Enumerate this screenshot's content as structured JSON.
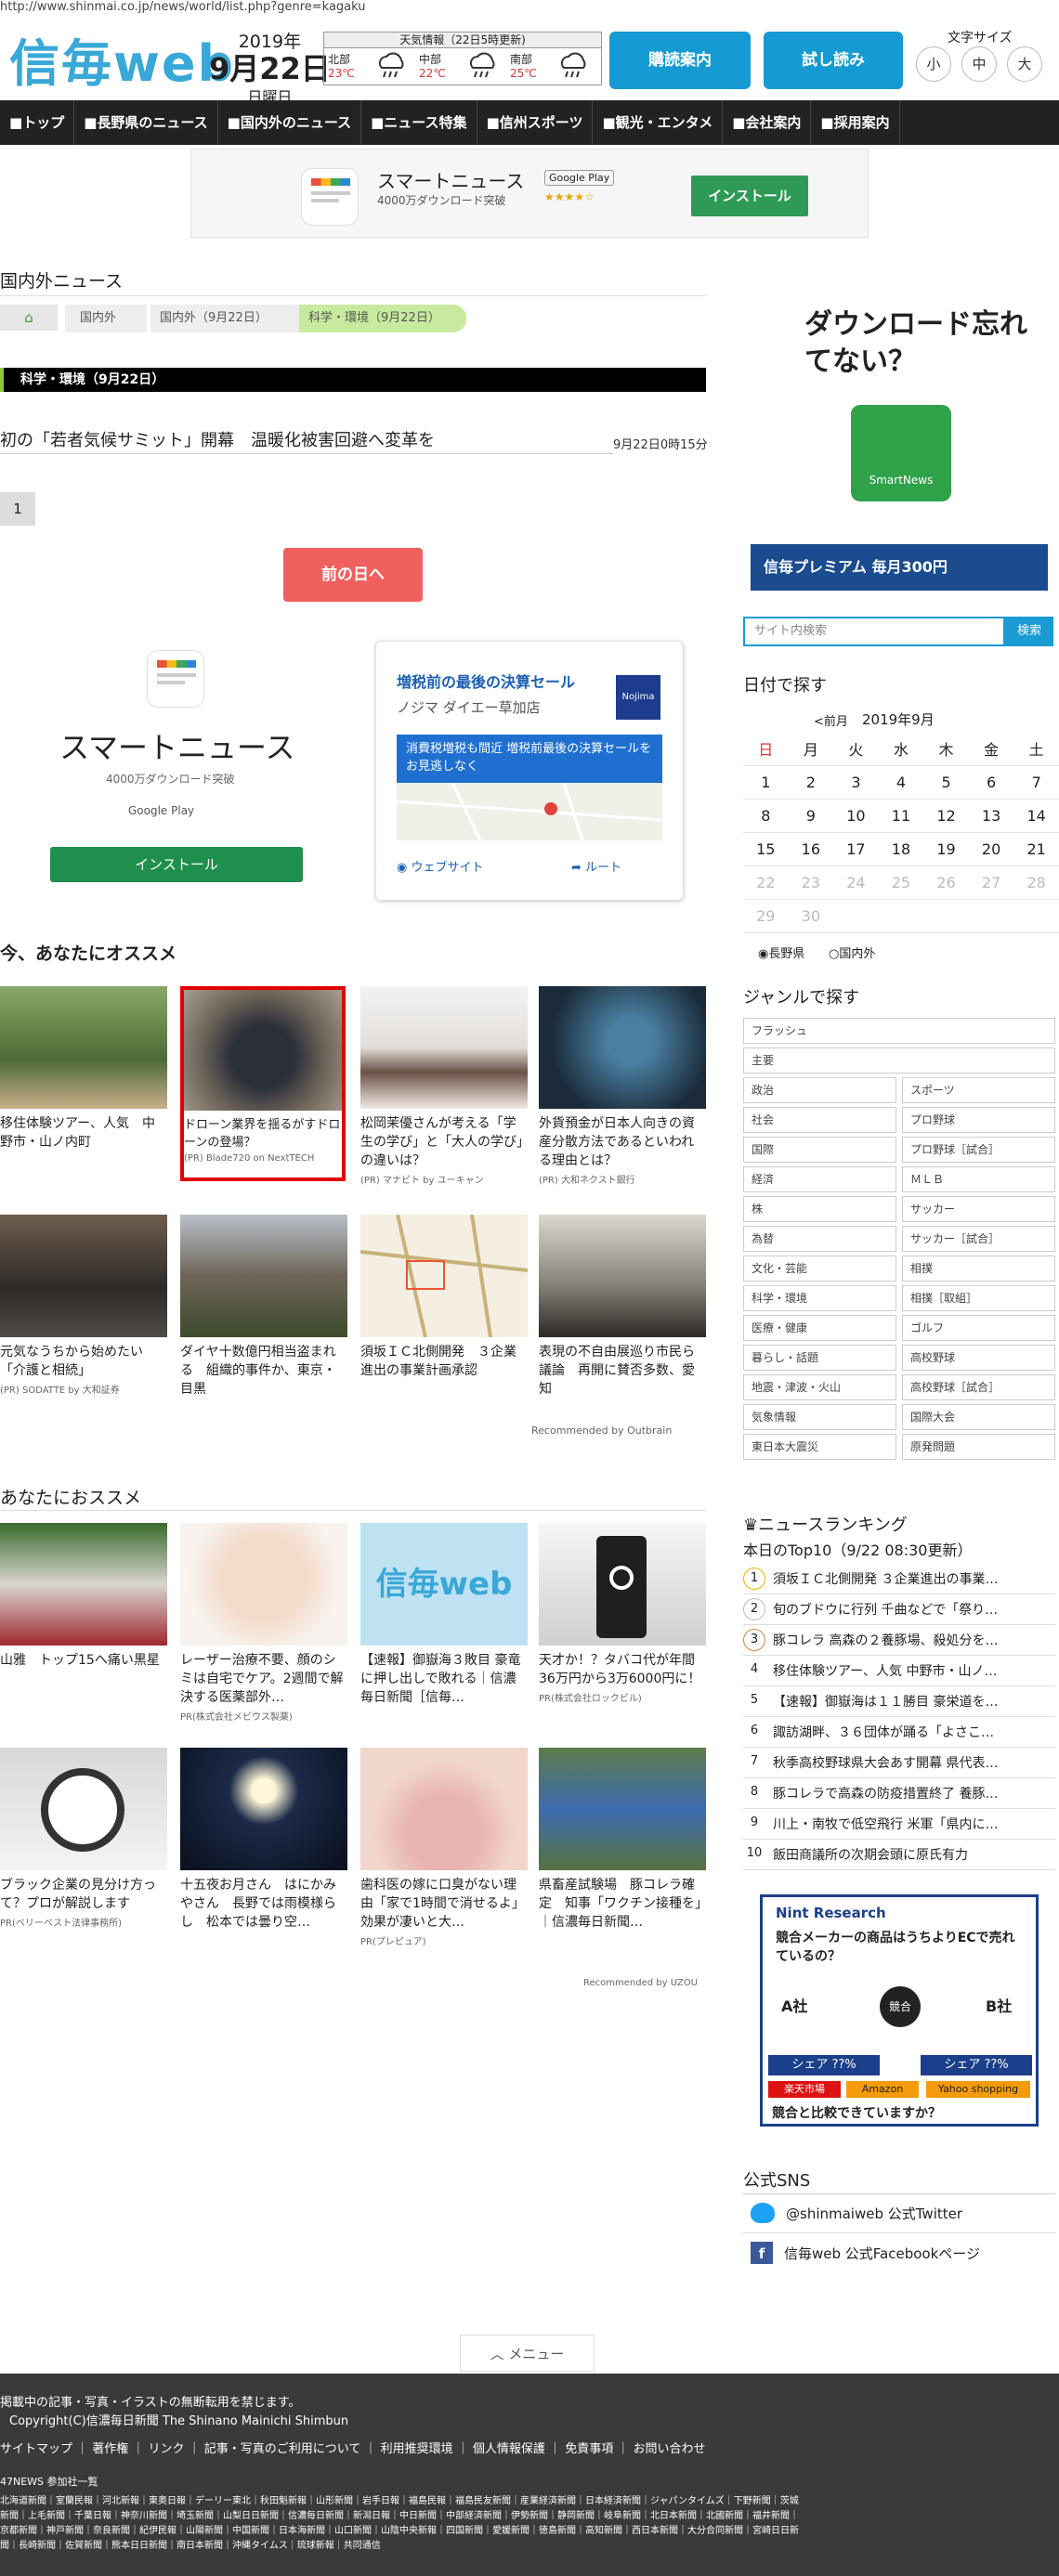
{
  "browser": {
    "url": "http://www.shinmai.co.jp/news/world/list.php?genre=kagaku"
  },
  "header": {
    "logo": "信毎web",
    "date_year": "2019年",
    "date_day": "9月22日",
    "date_weekday": "日曜日",
    "weather_title": "天気情報（22日5時更新)",
    "weather": [
      {
        "region": "北部",
        "temp": "23℃"
      },
      {
        "region": "中部",
        "temp": "22℃"
      },
      {
        "region": "南部",
        "temp": "25℃"
      }
    ],
    "subscribe_label": "購読案内",
    "trial_label": "試し読み",
    "font_size_label": "文字サイズ",
    "font_sizes": [
      "小",
      "中",
      "大"
    ]
  },
  "nav": [
    "トップ",
    "長野県のニュース",
    "国内外のニュース",
    "ニュース特集",
    "信州スポーツ",
    "観光・エンタメ",
    "会社案内",
    "採用案内"
  ],
  "top_ad": {
    "title": "スマートニュース",
    "sub": "4000万ダウンロード突破",
    "store": "Google Play",
    "install": "インストール"
  },
  "main": {
    "section_title": "国内外ニュース",
    "breadcrumb": [
      "国内外",
      "国内外（9月22日）",
      "科学・環境（9月22日）"
    ],
    "category_header": "科学・環境（9月22日）",
    "headline": "初の「若者気候サミット」開幕　温暖化被害回避へ変革を",
    "headline_date": "9月22日0時15分",
    "page_number": "1",
    "prev_day": "前の日へ"
  },
  "mid_ads": {
    "left": {
      "title": "スマートニュース",
      "sub": "4000万ダウンロード突破",
      "store": "Google Play",
      "install": "インストール"
    },
    "right": {
      "title": "増税前の最後の決算セール",
      "place": "ノジマ ダイエー草加店",
      "banner": "消費税増税も間近 増税前最後の決算セールを お見逃しなく",
      "website": "ウェブサイト",
      "route": "ルート",
      "brand": "Nojima"
    }
  },
  "recommend1": {
    "title": "今、あなたにオススメ",
    "items": [
      {
        "cap": "移住体験ツアー、人気　中野市・山ノ内町",
        "pr": ""
      },
      {
        "cap": "ドローン業界を揺るがすドローンの登場？",
        "pr": "(PR) Blade720 on NextTECH"
      },
      {
        "cap": "松岡茉優さんが考える「学生の学び」と「大人の学び」の違いは？",
        "pr": "(PR) マナビト by ユーキャン"
      },
      {
        "cap": "外貨預金が日本人向きの資産分散方法であるといわれる理由とは？",
        "pr": "(PR) 大和ネクスト銀行"
      },
      {
        "cap": "元気なうちから始めたい「介護と相続」",
        "pr": "(PR) SODATTE by 大和証券"
      },
      {
        "cap": "ダイヤ十数億円相当盗まれる　組織的事件か、東京・目黒",
        "pr": ""
      },
      {
        "cap": "須坂ＩＣ北側開発　３企業進出の事業計画承認",
        "pr": ""
      },
      {
        "cap": "表現の不自由展巡り市民ら議論　再開に賛否多数、愛知",
        "pr": ""
      }
    ],
    "credit": "Recommended by Outbrain"
  },
  "recommend2": {
    "title": "あなたにおススメ",
    "items": [
      {
        "cap": "山雅　トップ15へ痛い黒星",
        "pr": ""
      },
      {
        "cap": "レーザー治療不要、顔のシミは自宅でケア。2週間で解決する医薬部外…",
        "pr": "PR(株式会社メビウス製薬)"
      },
      {
        "cap": "【速報】御嶽海３敗目 豪竜に押し出しで敗れる｜信濃毎日新聞［信毎…",
        "pr": ""
      },
      {
        "cap": "天才か！？タバコ代が年間36万円から3万6000円に！",
        "pr": "PR(株式会社ロックビル)"
      },
      {
        "cap": "ブラック企業の見分け方って？プロが解説します",
        "pr": "PR(ベリーベスト法律事務所)"
      },
      {
        "cap": "十五夜お月さん　はにかみやさん　長野では雨模様らし　松本では曇り空…",
        "pr": ""
      },
      {
        "cap": "歯科医の嫁に口臭がない理由「家で1時間で消せるよ」効果が凄いと大…",
        "pr": "PR(プレピュア)"
      },
      {
        "cap": "県畜産試験場　豚コレラ確定　知事「ワクチン接種を」｜信濃毎日新聞…",
        "pr": ""
      }
    ],
    "credit": "Recommended by UZOU"
  },
  "sidebar": {
    "ad_text": "ダウンロード忘れてない？",
    "smartnews": "SmartNews",
    "premium_ad": "信毎プレミアム 毎月300円",
    "search_placeholder": "サイト内検索",
    "search_btn": "検索",
    "date_title": "日付で探す",
    "prev_month": "<前月",
    "month": "2019年9月",
    "weekdays": [
      "日",
      "月",
      "火",
      "水",
      "木",
      "金",
      "土"
    ],
    "calendar": [
      [
        "1",
        "2",
        "3",
        "4",
        "5",
        "6",
        "7"
      ],
      [
        "8",
        "9",
        "10",
        "11",
        "12",
        "13",
        "14"
      ],
      [
        "15",
        "16",
        "17",
        "18",
        "19",
        "20",
        "21"
      ],
      [
        "22",
        "23",
        "24",
        "25",
        "26",
        "27",
        "28"
      ],
      [
        "29",
        "30",
        "",
        "",
        "",
        "",
        ""
      ]
    ],
    "scope": [
      "長野県",
      "国内外"
    ],
    "genre_title": "ジャンルで探す",
    "genre_full": [
      "フラッシュ",
      "主要"
    ],
    "genre_pairs": [
      [
        "政治",
        "スポーツ"
      ],
      [
        "社会",
        "プロ野球"
      ],
      [
        "国際",
        "プロ野球［試合］"
      ],
      [
        "経済",
        "ＭＬＢ"
      ],
      [
        "株",
        "サッカー"
      ],
      [
        "為替",
        "サッカー［試合］"
      ],
      [
        "文化・芸能",
        "相撲"
      ],
      [
        "科学・環境",
        "相撲［取組］"
      ],
      [
        "医療・健康",
        "ゴルフ"
      ],
      [
        "暮らし・話題",
        "高校野球"
      ],
      [
        "地震・津波・火山",
        "高校野球［試合］"
      ],
      [
        "気象情報",
        "国際大会"
      ],
      [
        "東日本大震災",
        "原発問題"
      ]
    ],
    "ranking_title": "ニュースランキング",
    "ranking_sub": "本日のTop10（9/22 08:30更新）",
    "ranking": [
      "須坂ＩＣ北側開発 ３企業進出の事業…",
      "旬のブドウに行列 千曲などで「祭り…",
      "豚コレラ 高森の２養豚場、殺処分を…",
      "移住体験ツアー、人気 中野市・山ノ…",
      "【速報】御嶽海は１１勝目 豪栄道を…",
      "諏訪湖畔、３６団体が踊る「よさこ…",
      "秋季高校野球県大会あす開幕 県代表…",
      "豚コレラで高森の防疫措置終了 養豚…",
      "川上・南牧で低空飛行 米軍「県内に…",
      "飯田商議所の次期会頭に原氏有力"
    ],
    "nint_ad": {
      "brand": "Nint Research",
      "q": "競合メーカーの商品はうちよりECで売れているの？",
      "a": "A社",
      "b": "B社",
      "mid": "競合",
      "share": "シェア ??%",
      "shops": [
        "楽天市場",
        "Amazon",
        "Yahoo shopping"
      ],
      "foot": "競合と比較できていますか？"
    },
    "sns_title": "公式SNS",
    "twitter": "@shinmaiweb 公式Twitter",
    "facebook": "信毎web 公式Facebookページ"
  },
  "menu_btn": "メニュー",
  "footer": {
    "notice": "掲載中の記事・写真・イラストの無断転用を禁じます。",
    "copyright": "Copyright(C)信濃毎日新聞 The Shinano Mainichi Shimbun",
    "links": "サイトマップ ｜ 著作権 ｜ リンク ｜ 記事・写真のご利用について ｜ 利用推奨環境 ｜ 個人情報保護 ｜ 免責事項 ｜ お問い合わせ",
    "group_title": "47NEWS 参加社一覧",
    "papers1": "北海道新聞｜室蘭民報｜河北新報｜東奥日報｜デーリー東北｜秋田魁新報｜山形新聞｜岩手日報｜福島民報｜福島民友新聞｜産業経済新聞｜日本経済新聞｜ジャパンタイムズ｜下野新聞｜茨城",
    "papers2": "新聞｜上毛新聞｜千葉日報｜神奈川新聞｜埼玉新聞｜山梨日日新聞｜信濃毎日新聞｜新潟日報｜中日新聞｜中部経済新聞｜伊勢新聞｜静岡新聞｜岐阜新聞｜北日本新聞｜北國新聞｜福井新聞｜",
    "papers3": "京都新聞｜神戸新聞｜奈良新聞｜紀伊民報｜山陽新聞｜中国新聞｜日本海新聞｜山口新聞｜山陰中央新報｜四国新聞｜愛媛新聞｜徳島新聞｜高知新聞｜西日本新聞｜大分合同新聞｜宮崎日日新",
    "papers4": "聞｜長崎新聞｜佐賀新聞｜熊本日日新聞｜南日本新聞｜沖縄タイムス｜琉球新報｜共同通信"
  }
}
